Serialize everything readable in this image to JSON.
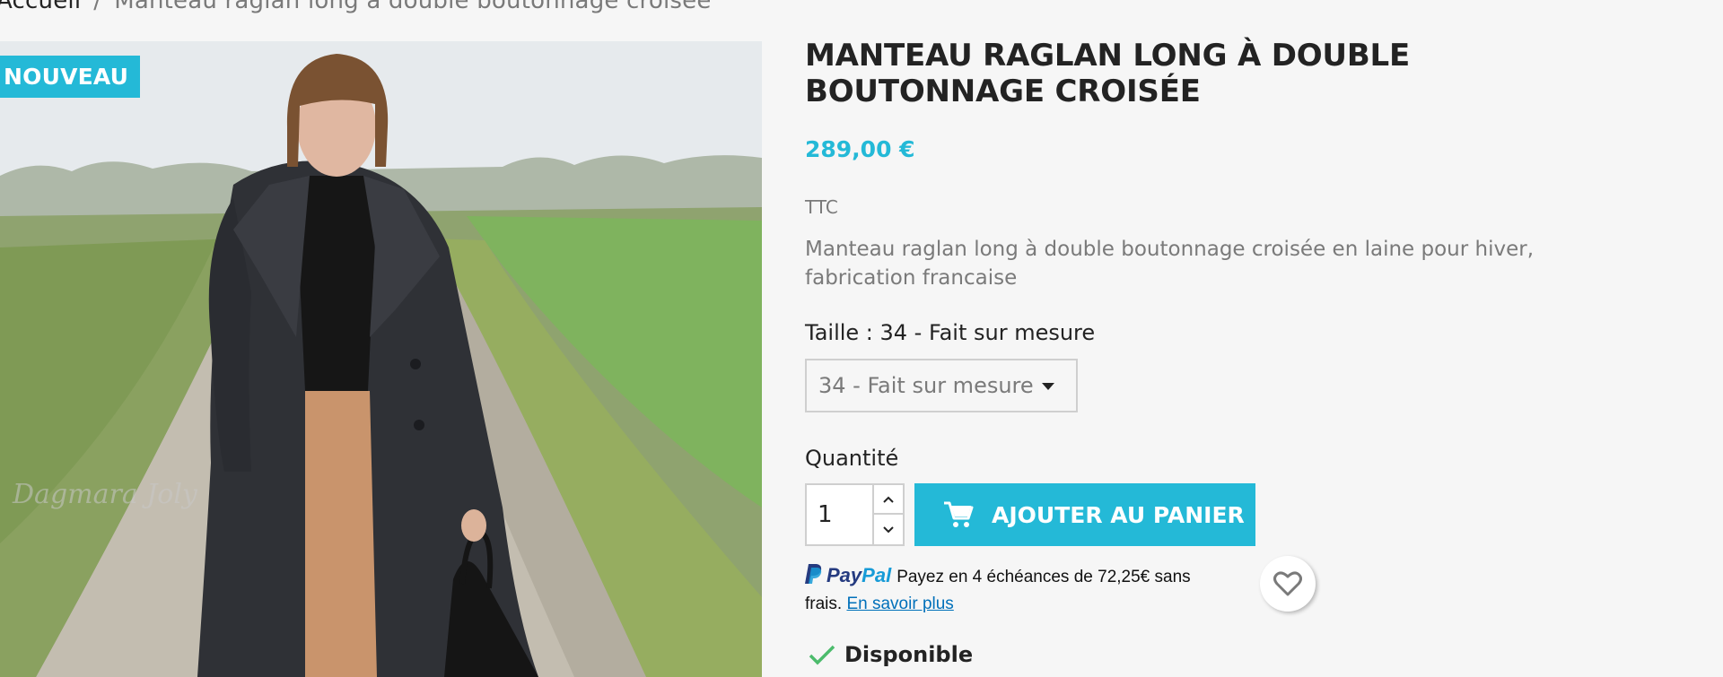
{
  "breadcrumb": {
    "home": "Accueil",
    "separator": "/",
    "current": "Manteau raglan long à double boutonnage croisée"
  },
  "product": {
    "badge": "NOUVEAU",
    "watermark": "Dagmara Joly",
    "title": "MANTEAU RAGLAN LONG À DOUBLE BOUTONNAGE CROISÉE",
    "price": "289,00 €",
    "tax_label": "TTC",
    "description": "Manteau raglan long à double boutonnage croisée en laine pour hiver, fabrication francaise",
    "image_icon": "product-photo"
  },
  "variant": {
    "label": "Taille : 34 - Fait sur mesure",
    "selected": "34 - Fait sur mesure"
  },
  "quantity": {
    "label": "Quantité",
    "value": "1"
  },
  "cart": {
    "button_label": "AJOUTER AU PANIER",
    "icon": "shopping-cart-icon"
  },
  "paypal": {
    "brand_pay": "Pay",
    "brand_pal": "Pal",
    "message": "Payez en 4 échéances de 72,25€ sans frais.",
    "link": "En savoir plus"
  },
  "wishlist": {
    "icon": "heart-icon"
  },
  "availability": {
    "label": "Disponible",
    "icon": "check-icon"
  },
  "colors": {
    "accent": "#24b9d7",
    "text": "#232323",
    "muted": "#7a7a7a",
    "background": "#f6f6f6",
    "paypal_blue": "#253b80",
    "paypal_light": "#179bd7",
    "link": "#0070ba"
  }
}
